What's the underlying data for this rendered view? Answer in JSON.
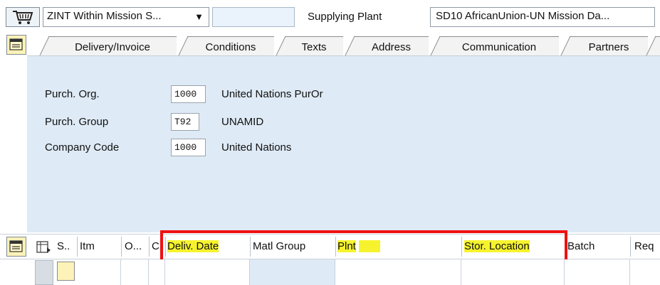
{
  "header": {
    "cart_icon": "shopping-cart-icon",
    "doc_type_value": "ZINT Within Mission S...",
    "vendor_value": "",
    "supplying_plant_label": "Supplying Plant",
    "supplying_plant_value": "SD10 AfricanUnion-UN Mission Da..."
  },
  "tabs": [
    {
      "label": "Delivery/Invoice"
    },
    {
      "label": "Conditions"
    },
    {
      "label": "Texts"
    },
    {
      "label": "Address"
    },
    {
      "label": "Communication"
    },
    {
      "label": "Partners"
    }
  ],
  "org_data": {
    "purch_org_label": "Purch. Org.",
    "purch_org_value": "1000",
    "purch_org_text": "United Nations PurOr",
    "purch_group_label": "Purch. Group",
    "purch_group_value": "T92",
    "purch_group_text": "UNAMID",
    "company_code_label": "Company Code",
    "company_code_value": "1000",
    "company_code_text": "United Nations"
  },
  "items": {
    "columns": [
      "S..",
      "Itm",
      "O...",
      "C",
      "Deliv. Date",
      "Matl Group",
      "Plnt",
      "Stor. Location",
      "Batch",
      "Req"
    ],
    "highlight_color": "#f6f32e",
    "box_color": "#ef1010"
  }
}
